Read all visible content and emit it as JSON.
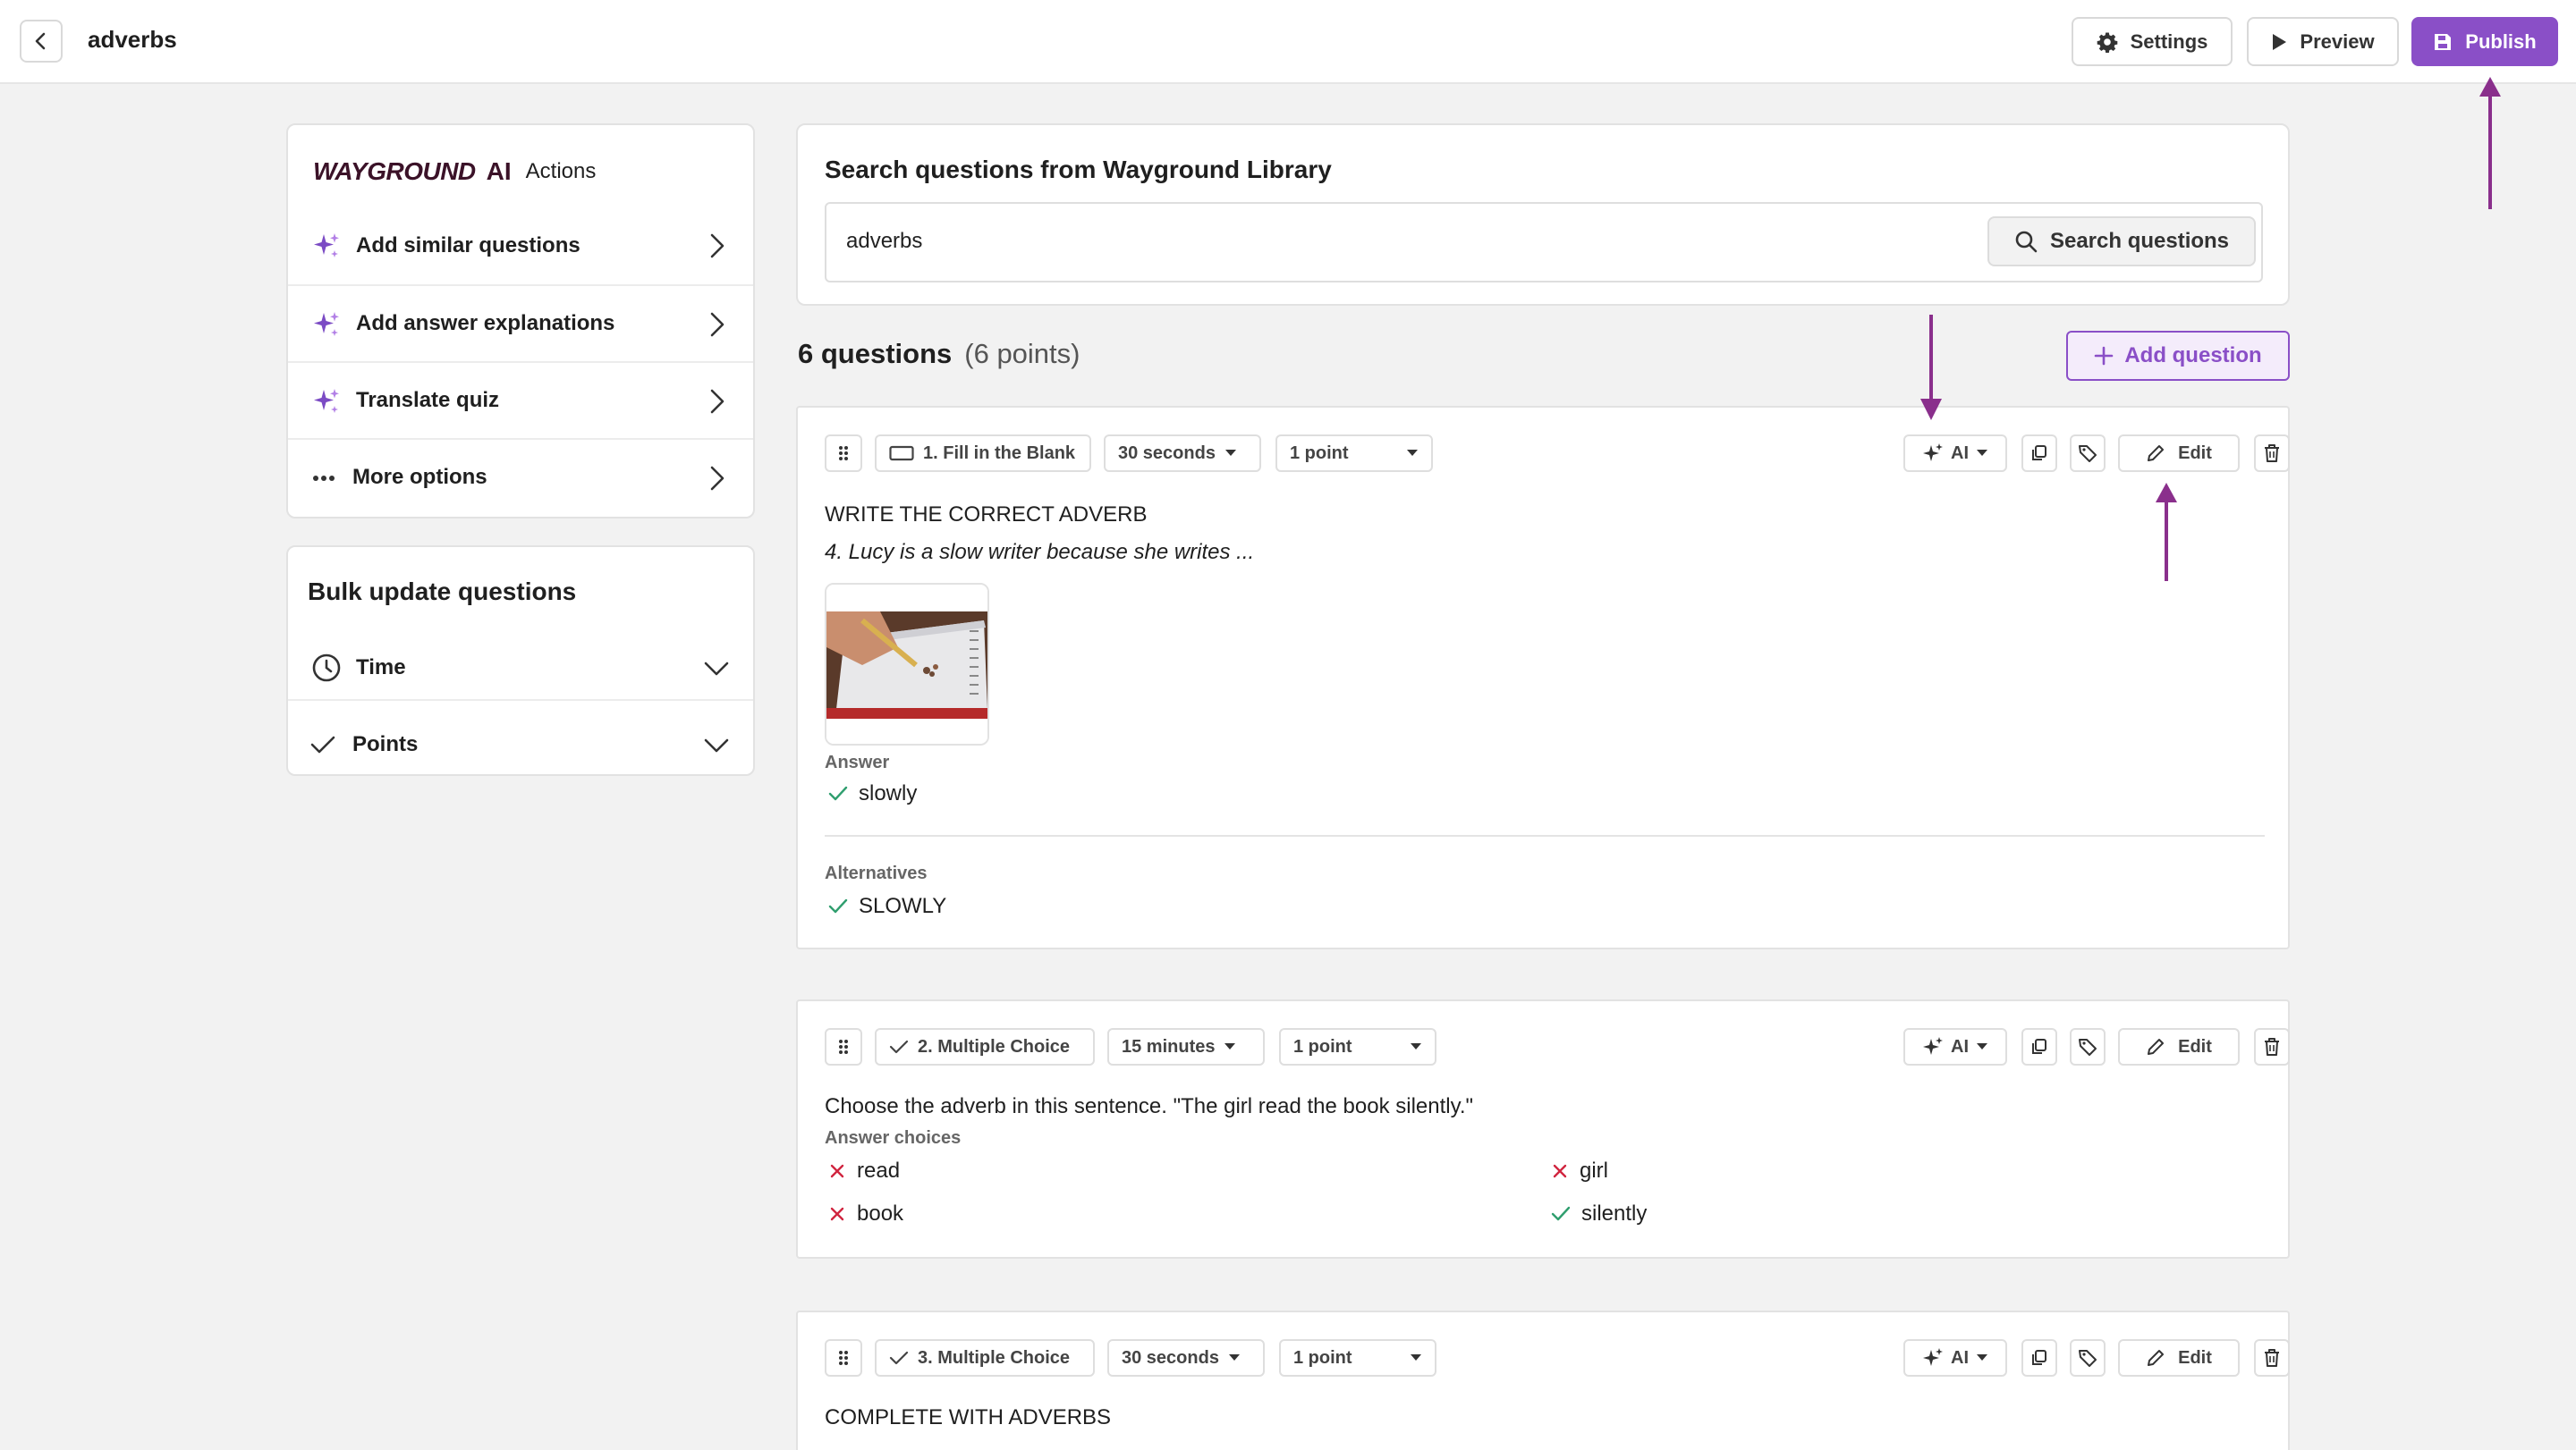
{
  "header": {
    "title": "adverbs",
    "settings_label": "Settings",
    "preview_label": "Preview",
    "publish_label": "Publish"
  },
  "ai_actions": {
    "brand": "WAYGROUND",
    "brand_ai": "AI",
    "label": "Actions",
    "items": [
      {
        "label": "Add similar questions",
        "icon": "sparkle-icon"
      },
      {
        "label": "Add answer explanations",
        "icon": "sparkle-icon"
      },
      {
        "label": "Translate quiz",
        "icon": "sparkle-icon"
      },
      {
        "label": "More options",
        "icon": "ellipsis-icon"
      }
    ]
  },
  "bulk_update": {
    "title": "Bulk update questions",
    "items": [
      {
        "label": "Time",
        "icon": "clock-icon"
      },
      {
        "label": "Points",
        "icon": "check-icon"
      }
    ]
  },
  "search": {
    "title": "Search questions from Wayground Library",
    "value": "adverbs",
    "button_label": "Search questions"
  },
  "summary": {
    "count_label": "6 questions",
    "points_label": "(6 points)",
    "add_question_label": "Add question"
  },
  "toolbar_common": {
    "ai_label": "AI",
    "edit_label": "Edit"
  },
  "questions": [
    {
      "type_label": "1. Fill in the Blank",
      "time_label": "30 seconds",
      "points_label": "1 point",
      "heading": "WRITE THE CORRECT ADVERB",
      "sub": "4. Lucy is a slow writer because she writes ...",
      "answer_label": "Answer",
      "answer": "slowly",
      "alternatives_label": "Alternatives",
      "alternative": "SLOWLY"
    },
    {
      "type_label": "2. Multiple Choice",
      "time_label": "15 minutes",
      "points_label": "1 point",
      "heading": "Choose the adverb in this sentence. \"The girl read the book silently.\"",
      "choices_label": "Answer choices",
      "choices": [
        {
          "text": "read",
          "correct": false
        },
        {
          "text": "girl",
          "correct": false
        },
        {
          "text": "book",
          "correct": false
        },
        {
          "text": "silently",
          "correct": true
        }
      ]
    },
    {
      "type_label": "3. Multiple Choice",
      "time_label": "30 seconds",
      "points_label": "1 point",
      "heading": "COMPLETE WITH ADVERBS"
    }
  ],
  "colors": {
    "accent": "#8a4fc7",
    "correct": "#2f9e6e",
    "incorrect": "#d0253f",
    "annotation_arrow": "#8a2f8c"
  }
}
